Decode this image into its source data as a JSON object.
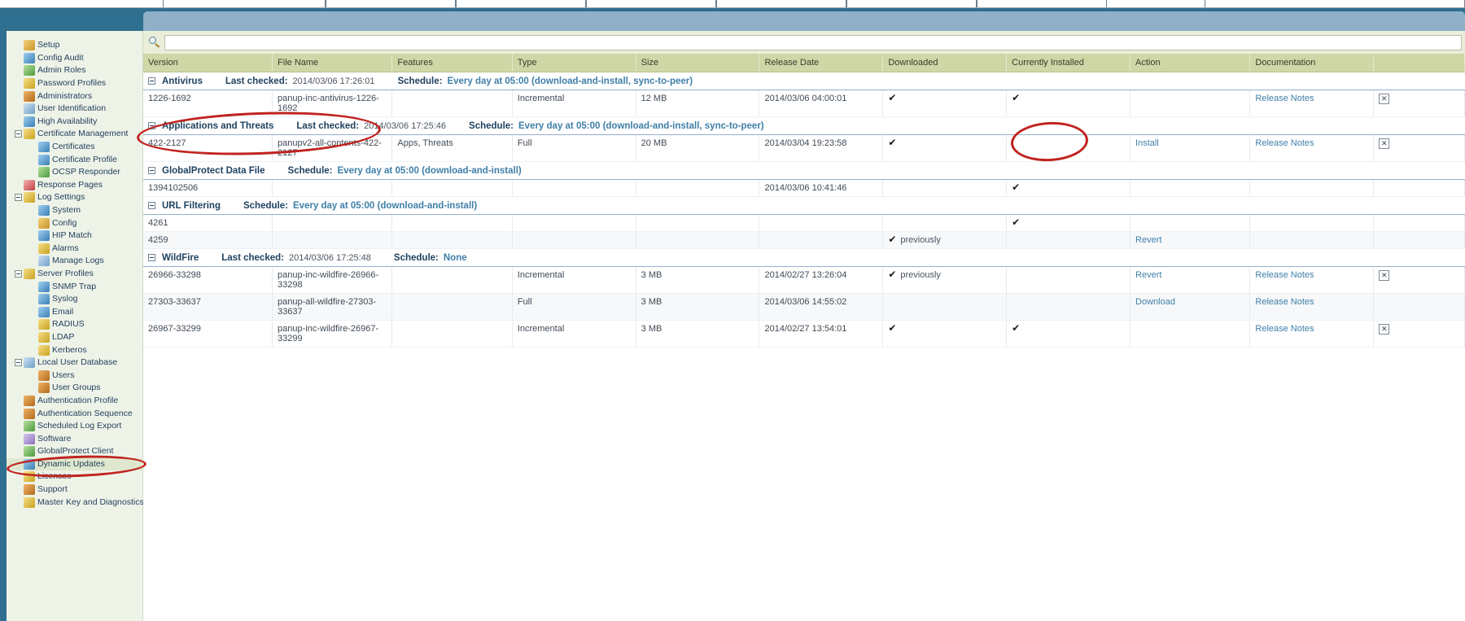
{
  "sidebar": {
    "items": [
      {
        "label": "Setup",
        "level": 1,
        "icon": "setup-icon",
        "ic": "ic-a",
        "exp": false
      },
      {
        "label": "Config Audit",
        "level": 1,
        "icon": "config-audit-icon",
        "ic": "ic-b",
        "exp": false
      },
      {
        "label": "Admin Roles",
        "level": 1,
        "icon": "admin-roles-icon",
        "ic": "ic-f",
        "exp": false
      },
      {
        "label": "Password Profiles",
        "level": 1,
        "icon": "password-profiles-icon",
        "ic": "ic-d",
        "exp": false
      },
      {
        "label": "Administrators",
        "level": 1,
        "icon": "administrators-icon",
        "ic": "ic-c",
        "exp": false
      },
      {
        "label": "User Identification",
        "level": 1,
        "icon": "user-identification-icon",
        "ic": "ic-e",
        "exp": false
      },
      {
        "label": "High Availability",
        "level": 1,
        "icon": "high-availability-icon",
        "ic": "ic-b",
        "exp": false
      },
      {
        "label": "Certificate Management",
        "level": 1,
        "icon": "certificate-management-icon",
        "ic": "ic-d",
        "exp": true
      },
      {
        "label": "Certificates",
        "level": 2,
        "icon": "certificates-icon",
        "ic": "ic-b",
        "exp": false
      },
      {
        "label": "Certificate Profile",
        "level": 2,
        "icon": "certificate-profile-icon",
        "ic": "ic-b",
        "exp": false
      },
      {
        "label": "OCSP Responder",
        "level": 2,
        "icon": "ocsp-responder-icon",
        "ic": "ic-f",
        "exp": false
      },
      {
        "label": "Response Pages",
        "level": 1,
        "icon": "response-pages-icon",
        "ic": "ic-g",
        "exp": false
      },
      {
        "label": "Log Settings",
        "level": 1,
        "icon": "log-settings-icon",
        "ic": "ic-d",
        "exp": true
      },
      {
        "label": "System",
        "level": 2,
        "icon": "system-log-icon",
        "ic": "ic-b",
        "exp": false
      },
      {
        "label": "Config",
        "level": 2,
        "icon": "config-log-icon",
        "ic": "ic-a",
        "exp": false
      },
      {
        "label": "HIP Match",
        "level": 2,
        "icon": "hip-match-icon",
        "ic": "ic-b",
        "exp": false
      },
      {
        "label": "Alarms",
        "level": 2,
        "icon": "alarms-icon",
        "ic": "ic-d",
        "exp": false
      },
      {
        "label": "Manage Logs",
        "level": 2,
        "icon": "manage-logs-icon",
        "ic": "ic-e",
        "exp": false
      },
      {
        "label": "Server Profiles",
        "level": 1,
        "icon": "server-profiles-icon",
        "ic": "ic-d",
        "exp": true
      },
      {
        "label": "SNMP Trap",
        "level": 2,
        "icon": "snmp-trap-icon",
        "ic": "ic-b",
        "exp": false
      },
      {
        "label": "Syslog",
        "level": 2,
        "icon": "syslog-icon",
        "ic": "ic-b",
        "exp": false
      },
      {
        "label": "Email",
        "level": 2,
        "icon": "email-icon",
        "ic": "ic-b",
        "exp": false
      },
      {
        "label": "RADIUS",
        "level": 2,
        "icon": "radius-icon",
        "ic": "ic-d",
        "exp": false
      },
      {
        "label": "LDAP",
        "level": 2,
        "icon": "ldap-icon",
        "ic": "ic-d",
        "exp": false
      },
      {
        "label": "Kerberos",
        "level": 2,
        "icon": "kerberos-icon",
        "ic": "ic-d",
        "exp": false
      },
      {
        "label": "Local User Database",
        "level": 1,
        "icon": "local-user-database-icon",
        "ic": "ic-e",
        "exp": true
      },
      {
        "label": "Users",
        "level": 2,
        "icon": "users-icon",
        "ic": "ic-c",
        "exp": false
      },
      {
        "label": "User Groups",
        "level": 2,
        "icon": "user-groups-icon",
        "ic": "ic-c",
        "exp": false
      },
      {
        "label": "Authentication Profile",
        "level": 1,
        "icon": "authentication-profile-icon",
        "ic": "ic-c",
        "exp": false
      },
      {
        "label": "Authentication Sequence",
        "level": 1,
        "icon": "authentication-sequence-icon",
        "ic": "ic-c",
        "exp": false
      },
      {
        "label": "Scheduled Log Export",
        "level": 1,
        "icon": "scheduled-log-export-icon",
        "ic": "ic-f",
        "exp": false
      },
      {
        "label": "Software",
        "level": 1,
        "icon": "software-icon",
        "ic": "ic-h",
        "exp": false
      },
      {
        "label": "GlobalProtect Client",
        "level": 1,
        "icon": "globalprotect-client-icon",
        "ic": "ic-f",
        "exp": false
      },
      {
        "label": "Dynamic Updates",
        "level": 1,
        "icon": "dynamic-updates-icon",
        "ic": "ic-b",
        "exp": false,
        "selected": true
      },
      {
        "label": "Licenses",
        "level": 1,
        "icon": "licenses-icon",
        "ic": "ic-d",
        "exp": false
      },
      {
        "label": "Support",
        "level": 1,
        "icon": "support-icon",
        "ic": "ic-c",
        "exp": false
      },
      {
        "label": "Master Key and Diagnostics",
        "level": 1,
        "icon": "master-key-icon",
        "ic": "ic-d",
        "exp": false
      }
    ]
  },
  "search": {
    "value": "",
    "placeholder": ""
  },
  "table": {
    "columns": [
      "Version",
      "File Name",
      "Features",
      "Type",
      "Size",
      "Release Date",
      "Downloaded",
      "Currently Installed",
      "Action",
      "Documentation",
      ""
    ],
    "labels": {
      "last_checked": "Last checked:",
      "schedule": "Schedule:"
    },
    "groups": [
      {
        "name": "Antivirus",
        "last_checked": "2014/03/06 17:26:01",
        "schedule": "Every day at 05:00 (download-and-install, sync-to-peer)",
        "rows": [
          {
            "version": "1226-1692",
            "file_name": "panup-inc-antivirus-1226-1692",
            "features": "",
            "type": "Incremental",
            "size": "12 MB",
            "release_date": "2014/03/06 04:00:01",
            "downloaded": "check",
            "downloaded_note": "",
            "installed": "check",
            "action": "",
            "documentation": "Release Notes",
            "delete": "x"
          }
        ]
      },
      {
        "name": "Applications and Threats",
        "last_checked": "2014/03/06 17:25:46",
        "schedule": "Every day at 05:00 (download-and-install, sync-to-peer)",
        "rows": [
          {
            "version": "422-2127",
            "file_name": "panupv2-all-contents-422-2127",
            "features": "Apps, Threats",
            "type": "Full",
            "size": "20 MB",
            "release_date": "2014/03/04 19:23:58",
            "downloaded": "check",
            "downloaded_note": "",
            "installed": "",
            "action": "Install",
            "documentation": "Release Notes",
            "delete": "x"
          }
        ]
      },
      {
        "name": "GlobalProtect Data File",
        "last_checked": "",
        "schedule": "Every day at 05:00 (download-and-install)",
        "rows": [
          {
            "version": "1394102506",
            "file_name": "",
            "features": "",
            "type": "",
            "size": "",
            "release_date": "2014/03/06 10:41:46",
            "downloaded": "",
            "downloaded_note": "",
            "installed": "check",
            "action": "",
            "documentation": "",
            "delete": ""
          }
        ]
      },
      {
        "name": "URL Filtering",
        "last_checked": "",
        "schedule": "Every day at 05:00 (download-and-install)",
        "rows": [
          {
            "version": "4261",
            "file_name": "",
            "features": "",
            "type": "",
            "size": "",
            "release_date": "",
            "downloaded": "",
            "downloaded_note": "",
            "installed": "check",
            "action": "",
            "documentation": "",
            "delete": ""
          },
          {
            "version": "4259",
            "file_name": "",
            "features": "",
            "type": "",
            "size": "",
            "release_date": "",
            "downloaded": "check",
            "downloaded_note": "previously",
            "installed": "",
            "action": "Revert",
            "documentation": "",
            "delete": ""
          }
        ]
      },
      {
        "name": "WildFire",
        "last_checked": "2014/03/06 17:25:48",
        "schedule": "None",
        "rows": [
          {
            "version": "26966-33298",
            "file_name": "panup-inc-wildfire-26966-33298",
            "features": "",
            "type": "Incremental",
            "size": "3 MB",
            "release_date": "2014/02/27 13:26:04",
            "downloaded": "check",
            "downloaded_note": "previously",
            "installed": "",
            "action": "Revert",
            "documentation": "Release Notes",
            "delete": "x"
          },
          {
            "version": "27303-33637",
            "file_name": "panup-all-wildfire-27303-33637",
            "features": "",
            "type": "Full",
            "size": "3 MB",
            "release_date": "2014/03/06 14:55:02",
            "downloaded": "",
            "downloaded_note": "",
            "installed": "",
            "action": "Download",
            "documentation": "Release Notes",
            "delete": ""
          },
          {
            "version": "26967-33299",
            "file_name": "panup-inc-wildfire-26967-33299",
            "features": "",
            "type": "Incremental",
            "size": "3 MB",
            "release_date": "2014/02/27 13:54:01",
            "downloaded": "check",
            "downloaded_note": "",
            "installed": "check",
            "action": "",
            "documentation": "Release Notes",
            "delete": "x"
          }
        ]
      }
    ]
  },
  "annotations": {
    "color": "#c0231f",
    "marks": [
      "applications-and-threats-row",
      "install-link",
      "dynamic-updates-nav-item"
    ]
  }
}
